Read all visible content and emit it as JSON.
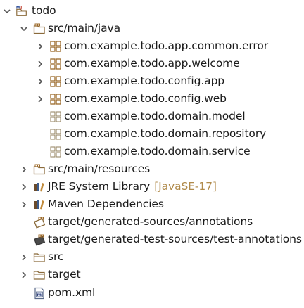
{
  "project_explorer": {
    "project": {
      "label": "todo"
    },
    "src_main_java": {
      "label": "src/main/java",
      "packages": [
        {
          "label": "com.example.todo.app.common.error"
        },
        {
          "label": "com.example.todo.app.welcome"
        },
        {
          "label": "com.example.todo.config.app"
        },
        {
          "label": "com.example.todo.config.web"
        },
        {
          "label": "com.example.todo.domain.model"
        },
        {
          "label": "com.example.todo.domain.repository"
        },
        {
          "label": "com.example.todo.domain.service"
        }
      ]
    },
    "src_main_resources": {
      "label": "src/main/resources"
    },
    "jre_library": {
      "label": "JRE System Library",
      "decoration": "[JavaSE-17]"
    },
    "maven_dependencies": {
      "label": "Maven Dependencies"
    },
    "generated_sources": {
      "label": "target/generated-sources/annotations"
    },
    "generated_test_sources": {
      "label": "target/generated-test-sources/test-annotations"
    },
    "src_folder": {
      "label": "src"
    },
    "target_folder": {
      "label": "target"
    },
    "pom_file": {
      "label": "pom.xml"
    }
  },
  "icons": {
    "expanded_twisty": "chevron-down-icon",
    "collapsed_twisty": "chevron-right-icon",
    "project": "maven-project-icon",
    "source_folder": "source-folder-icon",
    "package": "package-icon",
    "empty_package": "empty-package-icon",
    "library": "library-icon",
    "folder": "folder-icon",
    "xml_file": "xml-file-icon"
  },
  "colors": {
    "text": "#1a1a1a",
    "decoration": "#b08a4a",
    "twisty": "#555555",
    "package": "#9c6a2a",
    "folder": "#8a6a3a",
    "library": "#6b4b2b"
  }
}
